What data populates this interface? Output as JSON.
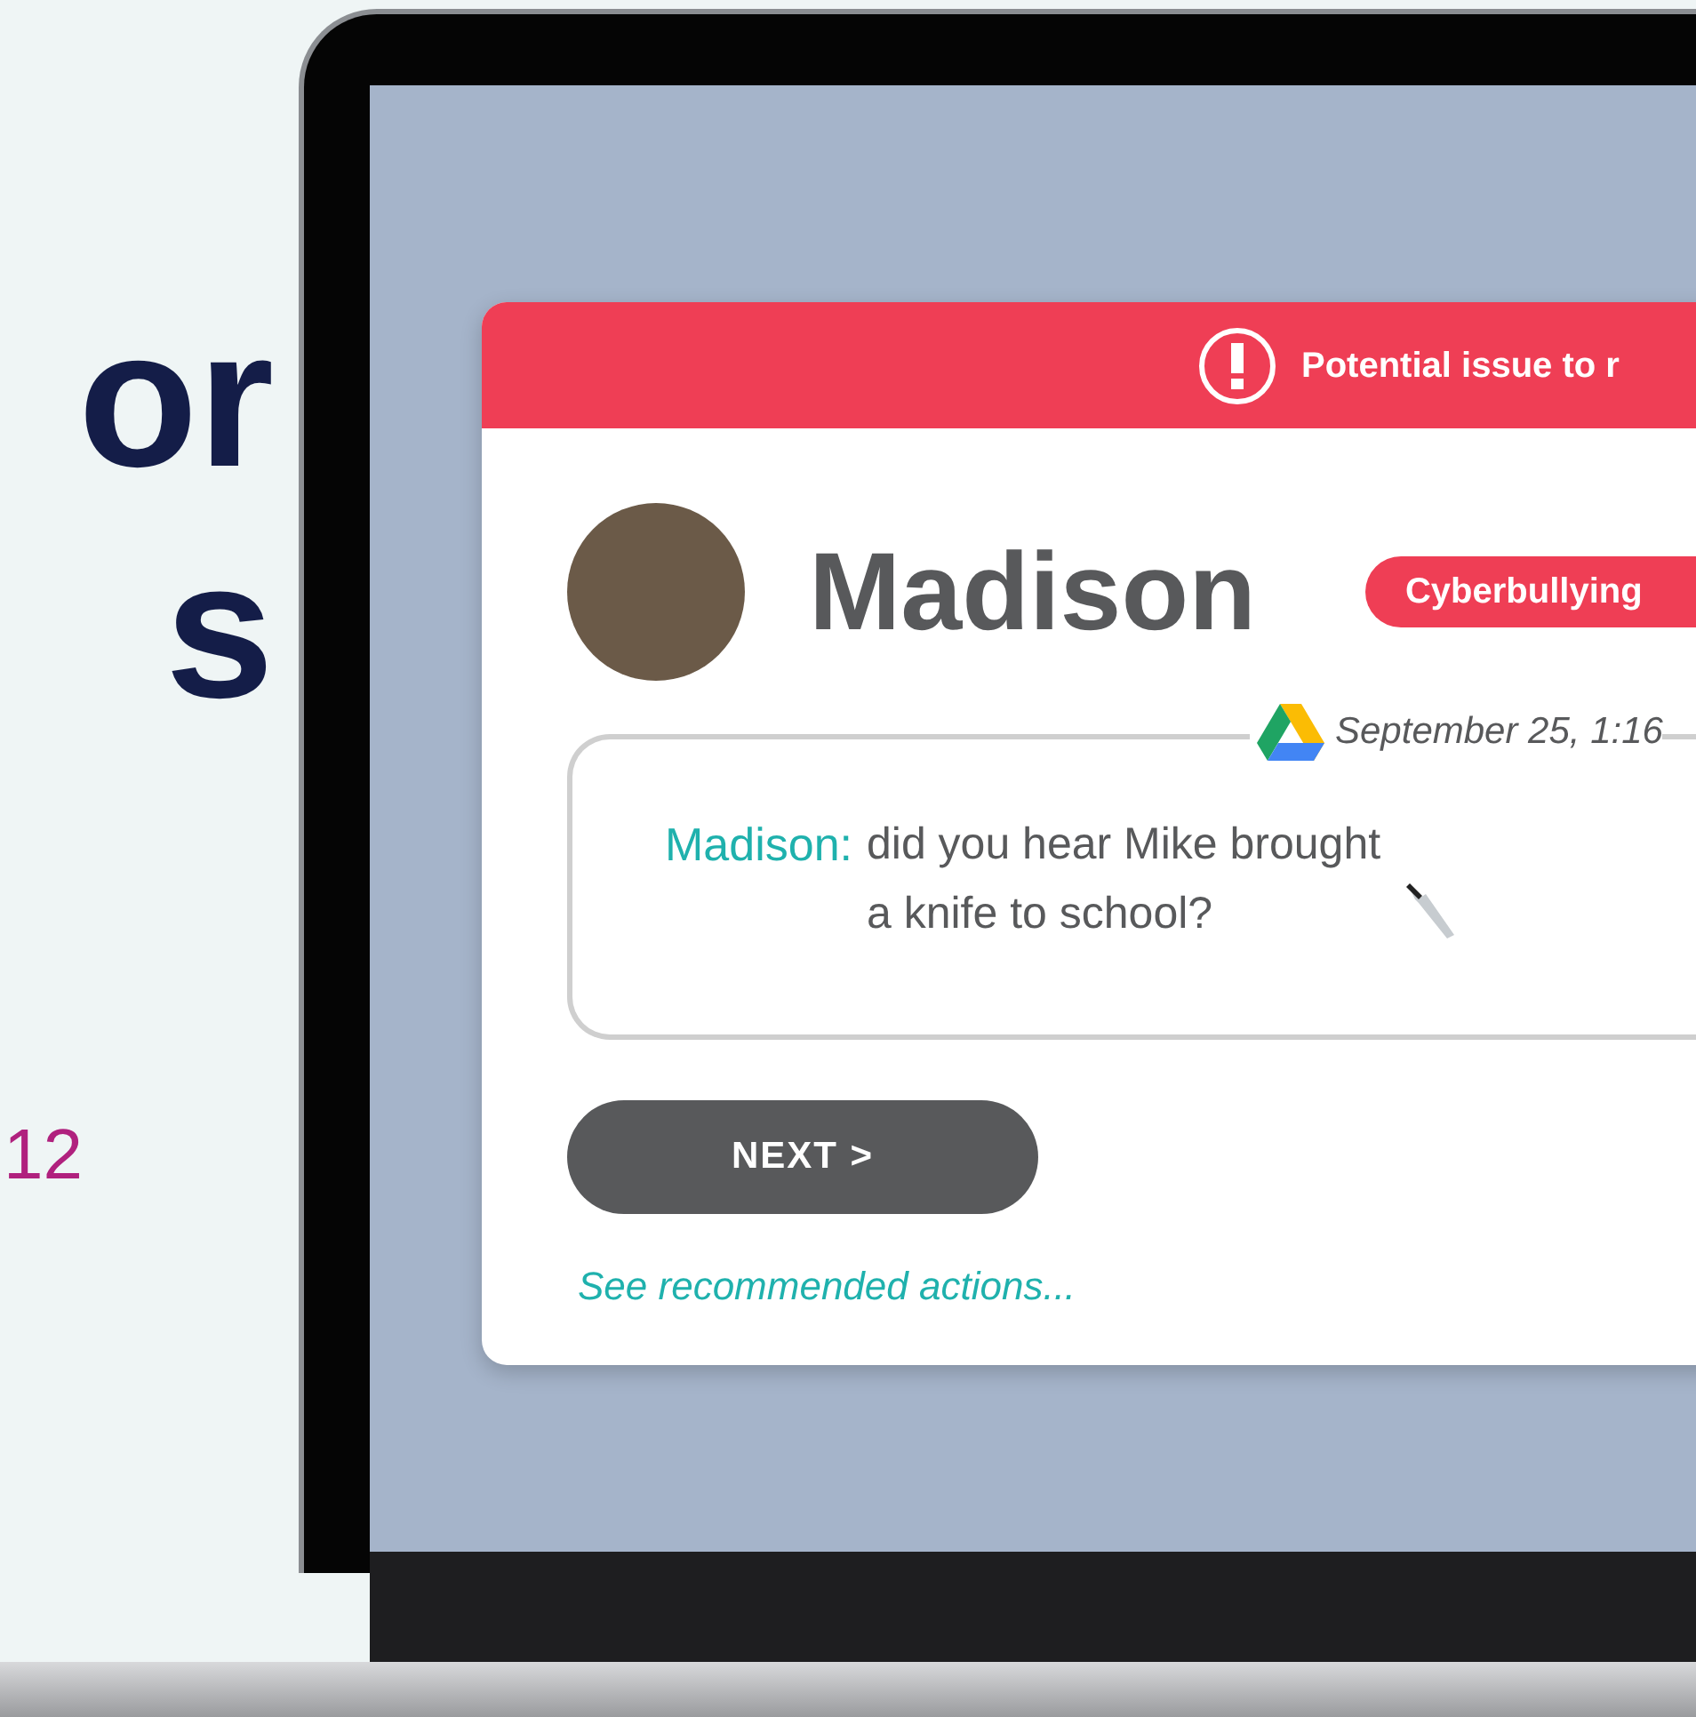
{
  "headline": {
    "lines": [
      "or",
      "s"
    ],
    "subtext": "12"
  },
  "alert": {
    "banner": "Potential issue to r",
    "name": "Madison",
    "tag": "Cyberbullying",
    "timestamp": "September 25, 1:16",
    "message": {
      "sender": "Madison:",
      "text": "did you hear Mike brought a knife to school?"
    },
    "button": "NEXT >",
    "link": "See recommended actions..."
  }
}
